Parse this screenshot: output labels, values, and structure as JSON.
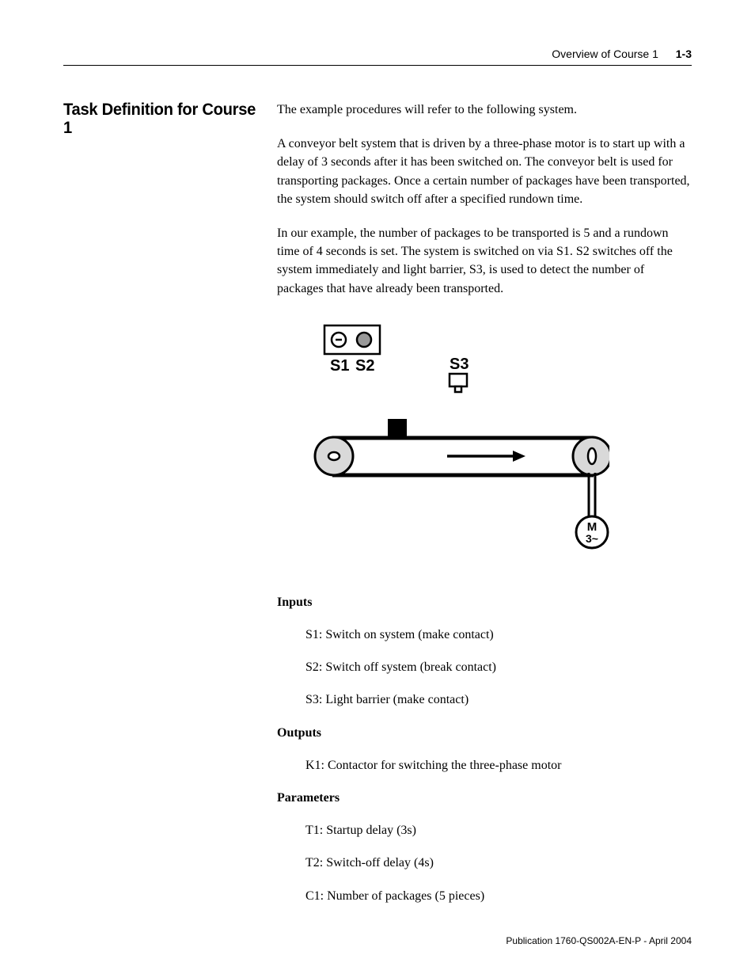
{
  "header": {
    "section": "Overview of Course 1",
    "page": "1-3"
  },
  "side_heading": "Task Definition for Course 1",
  "intro": "The example procedures will refer to the following system.",
  "para1": "A conveyor belt system that is driven by a three-phase motor is to start up with a delay of 3 seconds after it has been switched on. The conveyor belt is used for transporting packages. Once a certain number of packages have been transported, the system should switch off after a specified rundown time.",
  "para2": "In our example, the number of packages to be transported is 5 and a rundown time of 4 seconds is set. The system is switched on via S1. S2 switches off the system immediately and light barrier, S3, is used to detect the number of packages that have already been transported.",
  "diagram": {
    "s1": "S1",
    "s2": "S2",
    "s3": "S3",
    "motor_line1": "M",
    "motor_line2": "3~"
  },
  "inputs_title": "Inputs",
  "inputs": [
    "S1: Switch on system (make contact)",
    "S2: Switch off system (break contact)",
    "S3: Light barrier (make contact)"
  ],
  "outputs_title": "Outputs",
  "outputs": [
    "K1: Contactor for switching the three-phase motor"
  ],
  "params_title": "Parameters",
  "params": [
    "T1: Startup delay (3s)",
    "T2: Switch-off delay (4s)",
    "C1: Number of packages (5 pieces)"
  ],
  "footer": "Publication 1760-QS002A-EN-P - April 2004"
}
